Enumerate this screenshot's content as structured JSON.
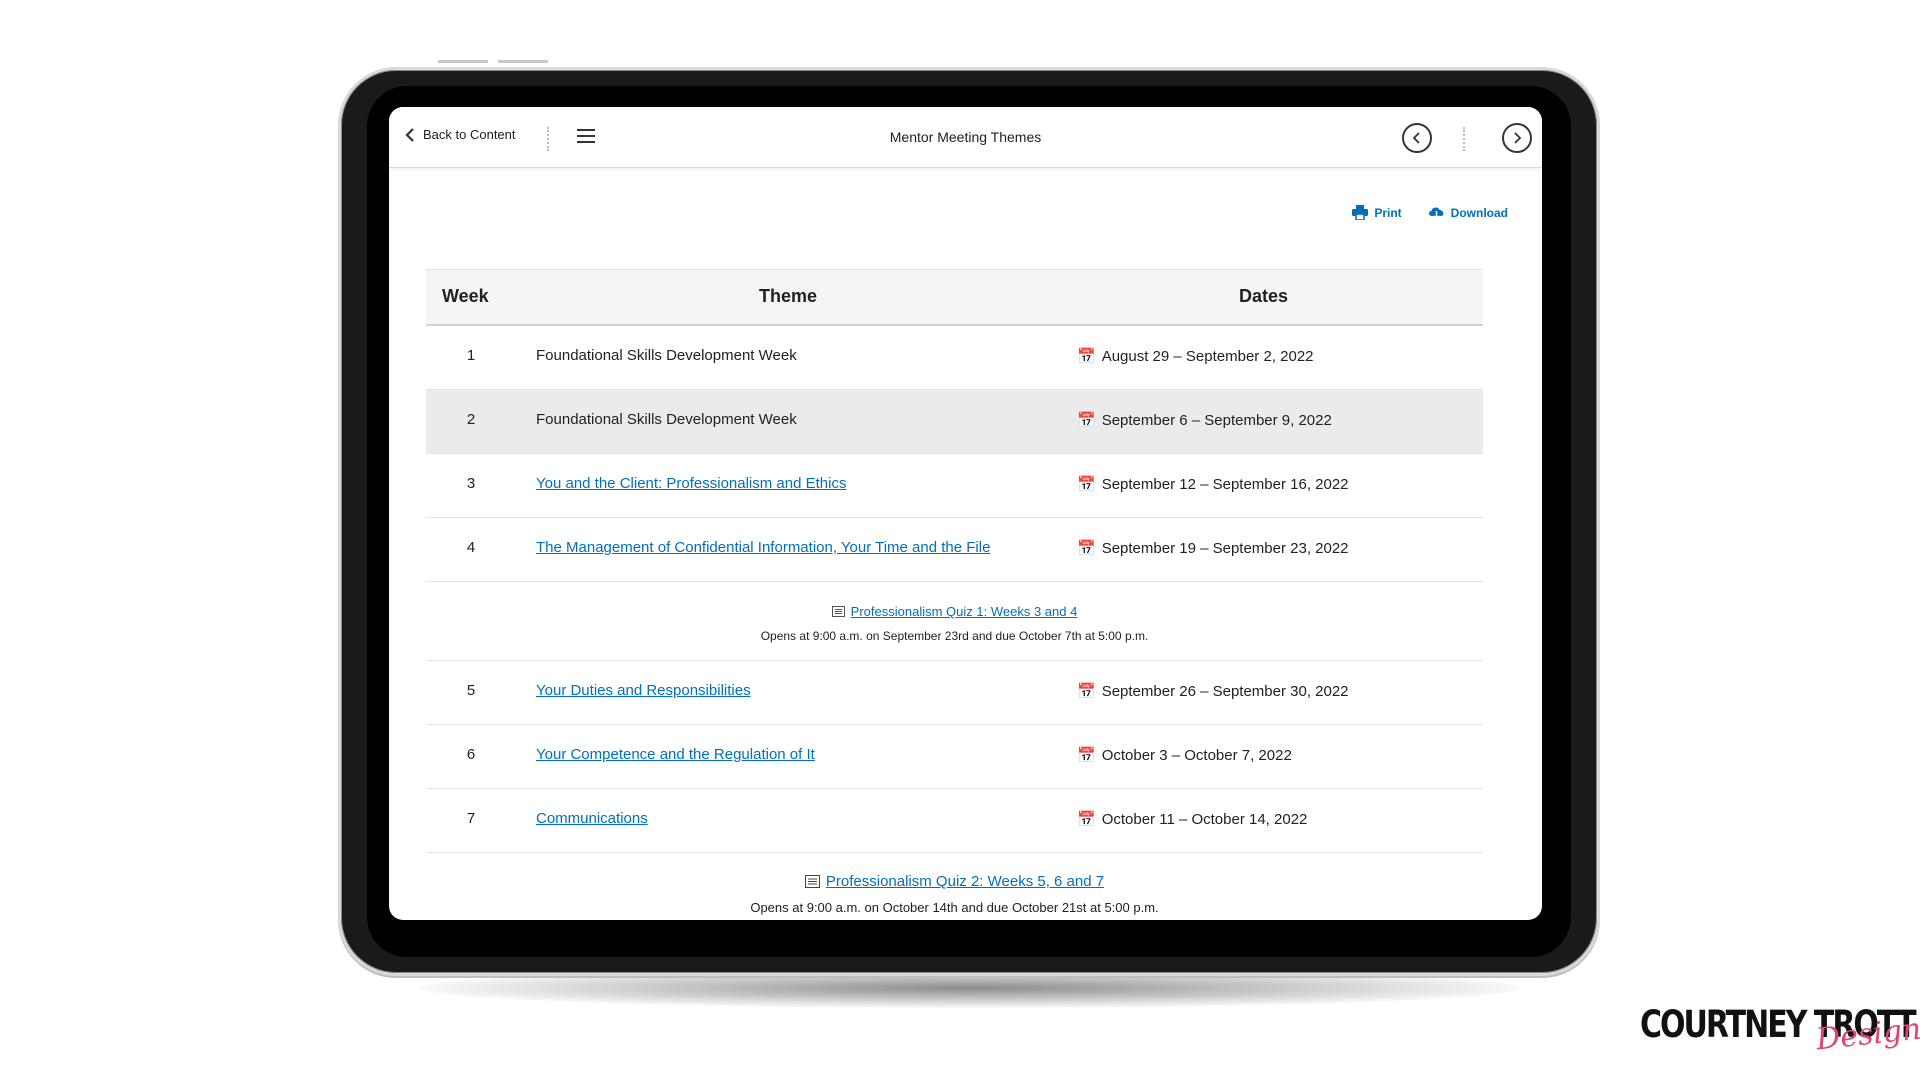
{
  "nav": {
    "back_label": "Back to Content",
    "title": "Mentor Meeting Themes"
  },
  "toolbar": {
    "print_label": "Print",
    "download_label": "Download"
  },
  "table": {
    "headers": {
      "week": "Week",
      "theme": "Theme",
      "dates": "Dates"
    },
    "rows": [
      {
        "week": "1",
        "theme": "Foundational Skills Development Week",
        "dates": "August 29 – September 2, 2022",
        "is_link": false
      },
      {
        "week": "2",
        "theme": "Foundational Skills Development Week",
        "dates": "September 6 – September 9, 2022",
        "is_link": false,
        "highlighted": true
      },
      {
        "week": "3",
        "theme": "You and the Client: Professionalism and Ethics",
        "dates": "September 12 – September 16, 2022",
        "is_link": true
      },
      {
        "week": "4",
        "theme": "The Management of Confidential Information, Your Time and the File",
        "dates": "September 19 – September 23, 2022",
        "is_link": true
      },
      {
        "week": "5",
        "theme": "Your Duties and Responsibilities",
        "dates": "September 26 – September 30, 2022",
        "is_link": true
      },
      {
        "week": "6",
        "theme": "Your Competence and the Regulation of It",
        "dates": "October 3 – October 7, 2022",
        "is_link": true
      },
      {
        "week": "7",
        "theme": "Communications",
        "dates": "October 11 – October 14, 2022",
        "is_link": true
      }
    ],
    "quizzes": [
      {
        "title": "Professionalism Quiz 1: Weeks 3 and 4",
        "note": "Opens at 9:00 a.m. on September 23rd and due October 7th at 5:00 p.m."
      },
      {
        "title": "Professionalism Quiz 2: Weeks 5, 6 and 7",
        "note": "Opens at 9:00 a.m. on October 14th and due October 21st at 5:00 p.m."
      }
    ]
  },
  "branding": {
    "logo_main": "COURTNEY TROTT",
    "logo_script": "Design"
  },
  "colors": {
    "link": "#006fbf",
    "logo_accent": "#e0436b"
  }
}
